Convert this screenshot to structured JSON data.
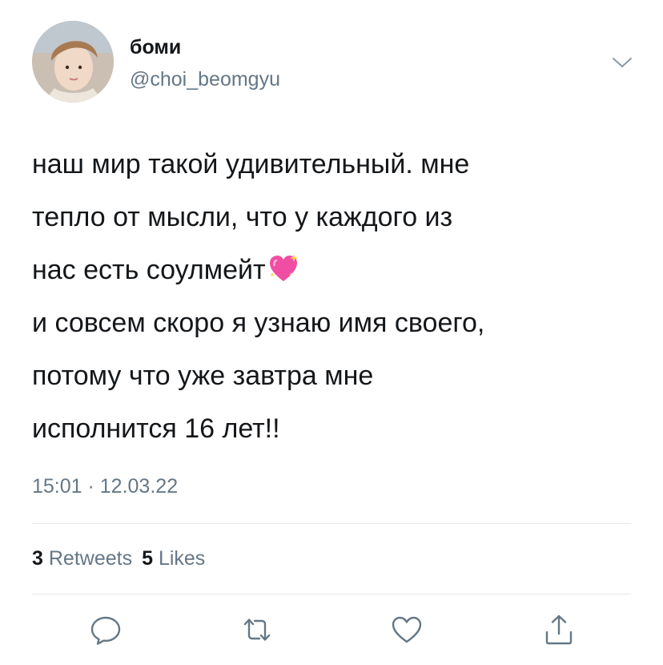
{
  "user": {
    "display_name": "боми",
    "handle": "@choi_beomgyu",
    "avatar_icon": "profile-photo"
  },
  "tweet": {
    "text_part1": "наш мир такой удивительный. мне\nтепло от мысли, что у каждого из\nнас есть соулмейт",
    "emoji_icon": "sparkling-heart-icon",
    "text_part2": "\nи совсем скоро я узнаю имя своего,\nпотому что уже завтра мне\nисполнится 16 лет!!",
    "timestamp": "15:01 · 12.03.22"
  },
  "stats": {
    "retweets_count": "3",
    "retweets_label": "Retweets",
    "likes_count": "5",
    "likes_label": "Likes"
  },
  "actions": [
    {
      "icon": "reply-icon"
    },
    {
      "icon": "retweet-icon"
    },
    {
      "icon": "like-icon"
    },
    {
      "icon": "share-icon"
    }
  ],
  "colors": {
    "text_primary": "#14171a",
    "text_secondary": "#657786",
    "divider": "#e1e8ed",
    "emoji_pink": "#f04ea3"
  }
}
